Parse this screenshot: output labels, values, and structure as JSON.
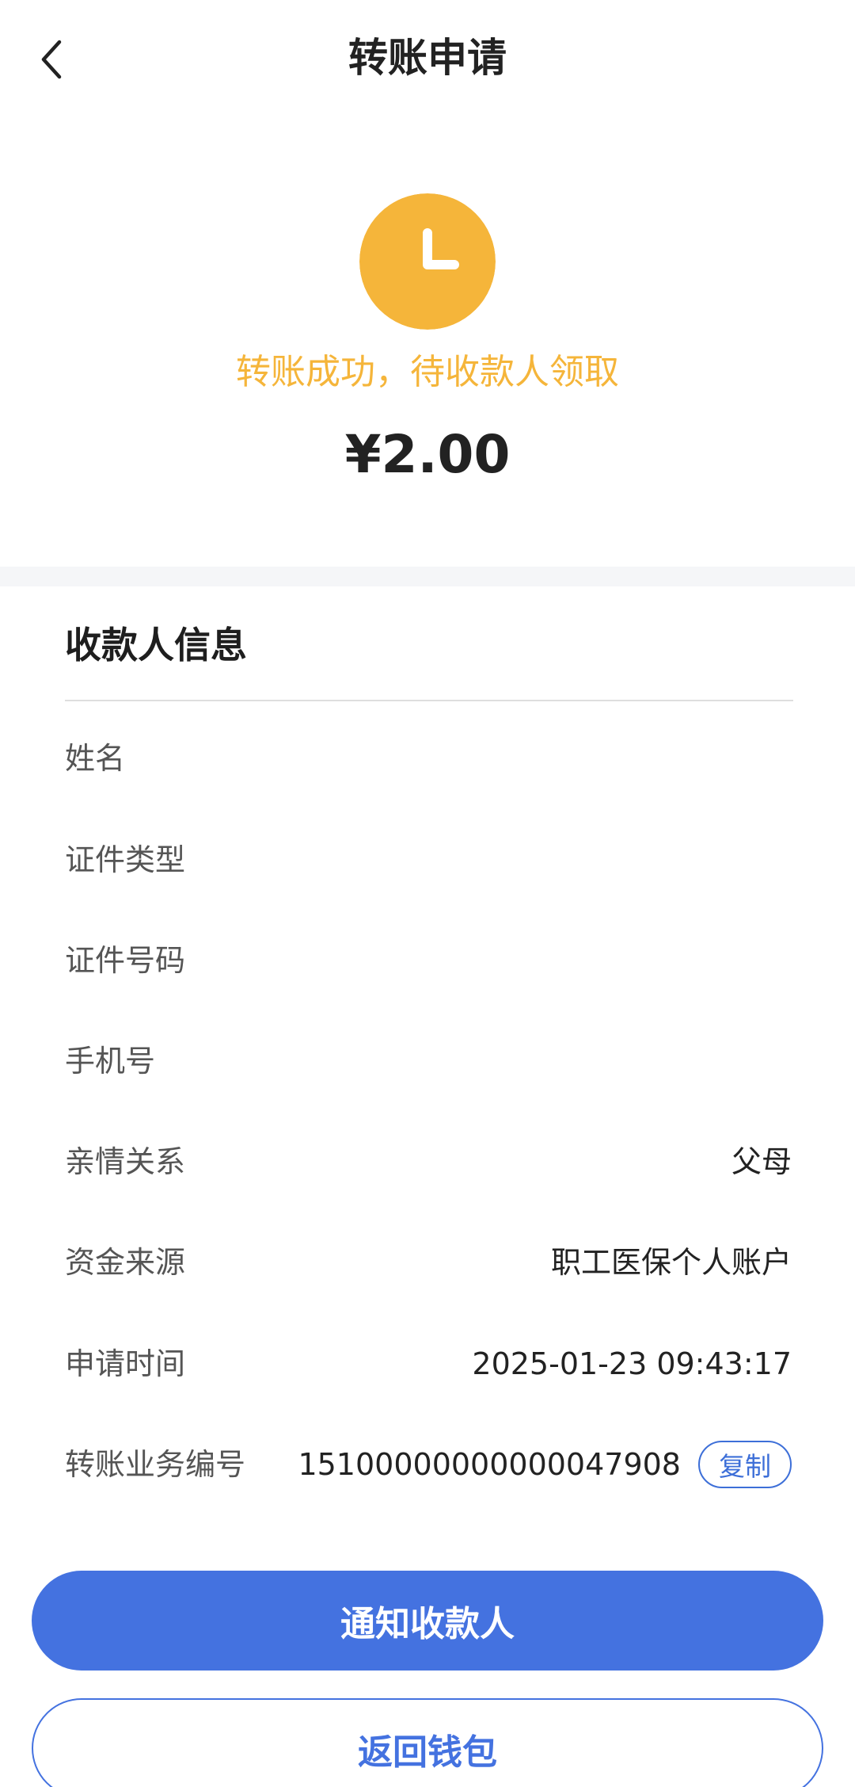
{
  "header": {
    "title": "转账申请"
  },
  "status": {
    "icon": "clock-icon",
    "text": "转账成功，待收款人领取",
    "amount": "¥2.00",
    "color": "#f5b53a"
  },
  "payee": {
    "section_title": "收款人信息",
    "rows": [
      {
        "label": "姓名",
        "value": ""
      },
      {
        "label": "证件类型",
        "value": ""
      },
      {
        "label": "证件号码",
        "value": ""
      },
      {
        "label": "手机号",
        "value": ""
      },
      {
        "label": "亲情关系",
        "value": "父母"
      },
      {
        "label": "资金来源",
        "value": "职工医保个人账户"
      },
      {
        "label": "申请时间",
        "value": "2025-01-23 09:43:17"
      },
      {
        "label": "转账业务编号",
        "value": "15100000000000047908"
      }
    ],
    "copy_label": "复制"
  },
  "buttons": {
    "notify_label": "通知收款人",
    "back_label": "返回钱包"
  },
  "colors": {
    "accent": "#4472e0",
    "pending": "#f5b53a"
  }
}
